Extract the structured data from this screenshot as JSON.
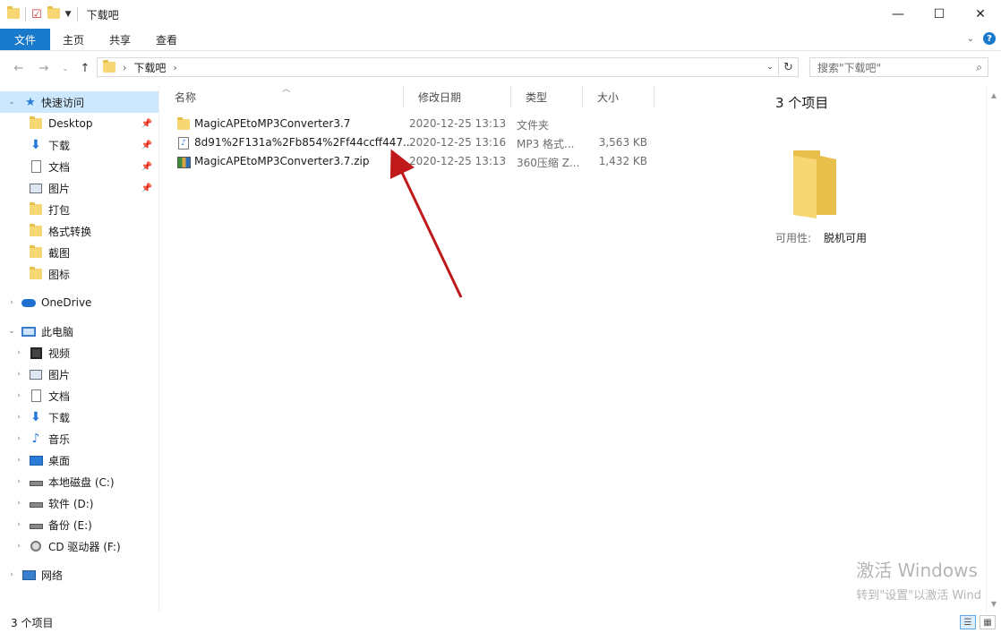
{
  "window": {
    "title": "下载吧",
    "controls": {
      "minimize": "—",
      "maximize": "☐",
      "close": "✕"
    }
  },
  "ribbon": {
    "tabs": [
      "文件",
      "主页",
      "共享",
      "查看"
    ],
    "help": "?"
  },
  "address": {
    "crumb": "下载吧",
    "search_placeholder": "搜索\"下载吧\""
  },
  "nav": {
    "quick_access": "快速访问",
    "quick_items": [
      "Desktop",
      "下载",
      "文档",
      "图片",
      "打包",
      "格式转换",
      "截图",
      "图标"
    ],
    "onedrive": "OneDrive",
    "this_pc": "此电脑",
    "pc_items": [
      "视频",
      "图片",
      "文档",
      "下载",
      "音乐",
      "桌面",
      "本地磁盘 (C:)",
      "软件 (D:)",
      "备份 (E:)",
      "CD 驱动器 (F:)"
    ],
    "network": "网络"
  },
  "columns": {
    "name": "名称",
    "date": "修改日期",
    "type": "类型",
    "size": "大小"
  },
  "files": [
    {
      "name": "MagicAPEtoMP3Converter3.7",
      "date": "2020-12-25 13:13",
      "type": "文件夹",
      "size": "",
      "icon": "folder-icon"
    },
    {
      "name": "8d91%2F131a%2Fb854%2Ff44ccff447...",
      "date": "2020-12-25 13:16",
      "type": "MP3 格式...",
      "size": "3,563 KB",
      "icon": "mp3-file-icon"
    },
    {
      "name": "MagicAPEtoMP3Converter3.7.zip",
      "date": "2020-12-25 13:13",
      "type": "360压缩 Z...",
      "size": "1,432 KB",
      "icon": "zip-file-icon"
    }
  ],
  "details": {
    "count": "3 个项目",
    "availability_label": "可用性:",
    "availability_value": "脱机可用"
  },
  "watermark": {
    "line1": "激活 Windows",
    "line2": "转到\"设置\"以激活 Wind"
  },
  "status": {
    "count": "3 个项目"
  },
  "colors": {
    "accent": "#1979ca",
    "selection": "#cce8ff",
    "arrow": "#c0191b",
    "folder": "#f7d774"
  }
}
